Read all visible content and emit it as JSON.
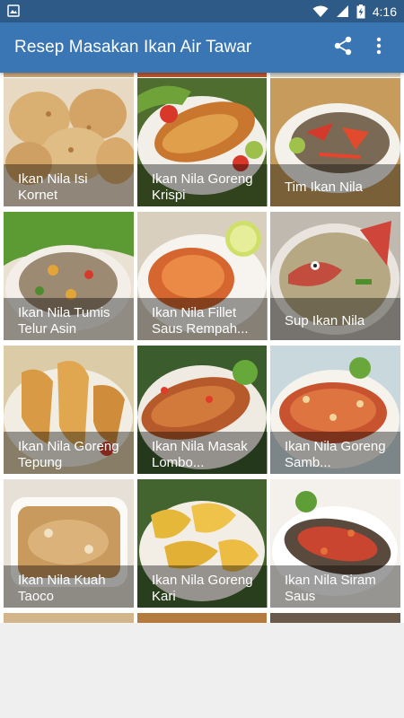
{
  "status_bar": {
    "time": "4:16",
    "icons": [
      "image-notification-icon",
      "wifi-icon",
      "signal-icon",
      "battery-charging-icon"
    ]
  },
  "app_bar": {
    "title": "Resep Masakan Ikan Air Tawar",
    "actions": [
      "share-icon",
      "more-vert-icon"
    ]
  },
  "recipes": [
    {
      "title": "Ikan Nila Isi Kornet"
    },
    {
      "title": "Ikan Nila Goreng Krispi"
    },
    {
      "title": "Tim Ikan Nila"
    },
    {
      "title": "Ikan Nila Tumis Telur Asin"
    },
    {
      "title": "Ikan Nila Fillet Saus Rempah..."
    },
    {
      "title": "Sup Ikan Nila"
    },
    {
      "title": "Ikan Nila Goreng Tepung"
    },
    {
      "title": "Ikan Nila Masak Lombo..."
    },
    {
      "title": "Ikan Nila Goreng Samb..."
    },
    {
      "title": "Ikan Nila Kuah Taoco"
    },
    {
      "title": "Ikan Nila Goreng Kari"
    },
    {
      "title": "Ikan Nila Siram Saus"
    }
  ],
  "colors": {
    "status_bar": "#2d5a86",
    "app_bar": "#3a76b3",
    "background": "#efefef"
  }
}
